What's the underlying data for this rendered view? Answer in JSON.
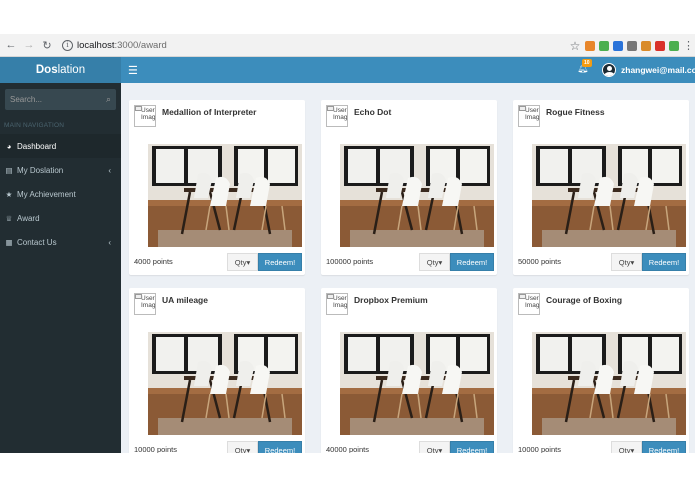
{
  "browser": {
    "url_host": "localhost",
    "url_path": ":3000/award",
    "extensions": [
      {
        "icon": "pumpkin-ext-icon",
        "color": "#e8862a"
      },
      {
        "icon": "shield-ext-icon",
        "color": "#4caf50"
      },
      {
        "icon": "pin-ext-icon",
        "color": "#2a73d9"
      },
      {
        "icon": "screen-ext-icon",
        "color": "#777777"
      },
      {
        "icon": "wand-ext-icon",
        "color": "#d98b2a"
      },
      {
        "icon": "p-ext-icon",
        "color": "#d9322a"
      },
      {
        "icon": "dot-ext-icon",
        "color": "#4caf50"
      }
    ]
  },
  "brand": {
    "bold": "Dos",
    "light": "lation"
  },
  "search": {
    "placeholder": "Search..."
  },
  "sidebar": {
    "header": "MAIN NAVIGATION",
    "items": [
      {
        "label": "Dashboard",
        "icon": "dashboard-icon",
        "glyph": "◕",
        "chevron": false,
        "active": true
      },
      {
        "label": "My Doslation",
        "icon": "list-icon",
        "glyph": "▤",
        "chevron": true,
        "active": false
      },
      {
        "label": "My Achievement",
        "icon": "star-icon",
        "glyph": "★",
        "chevron": false,
        "active": false
      },
      {
        "label": "Award",
        "icon": "trophy-icon",
        "glyph": "♕",
        "chevron": false,
        "active": false
      },
      {
        "label": "Contact Us",
        "icon": "table-icon",
        "glyph": "▦",
        "chevron": true,
        "active": false
      }
    ]
  },
  "topbar": {
    "notification_count": "10",
    "user_email": "zhangwei@mail.com"
  },
  "colors": {
    "sidebar": "#222d32",
    "brand": "#367fa9",
    "topbar": "#3c8dbc",
    "accent": "#3c8dbc"
  },
  "awards": [
    {
      "title": "Medallion of Interpreter",
      "points": "4000 points",
      "thumb_alt": "User Image",
      "qty_label": "Qty",
      "redeem_label": "Redeem!"
    },
    {
      "title": "Echo Dot",
      "points": "100000 points",
      "thumb_alt": "User Image",
      "qty_label": "Qty",
      "redeem_label": "Redeem!"
    },
    {
      "title": "Rogue Fitness",
      "points": "50000 points",
      "thumb_alt": "User Image",
      "qty_label": "Qty",
      "redeem_label": "Redeem!"
    },
    {
      "title": "UA mileage",
      "points": "10000 points",
      "thumb_alt": "User Image",
      "qty_label": "Qty",
      "redeem_label": "Redeem!"
    },
    {
      "title": "Dropbox Premium",
      "points": "40000 points",
      "thumb_alt": "User Image",
      "qty_label": "Qty",
      "redeem_label": "Redeem!"
    },
    {
      "title": "Courage of Boxing",
      "points": "10000 points",
      "thumb_alt": "User Image",
      "qty_label": "Qty",
      "redeem_label": "Redeem!"
    }
  ]
}
